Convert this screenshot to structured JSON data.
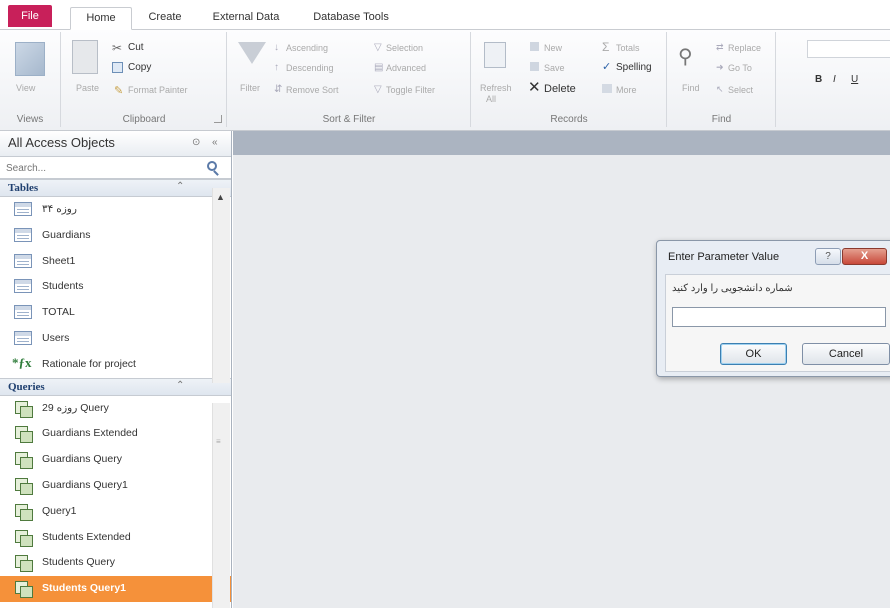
{
  "tabs": [
    {
      "label": "File"
    },
    {
      "label": "Home"
    },
    {
      "label": "Create"
    },
    {
      "label": "External Data"
    },
    {
      "label": "Database Tools"
    }
  ],
  "ribbon": {
    "views": {
      "view": "View",
      "group": "Views"
    },
    "clipboard": {
      "paste": "Paste",
      "cut": "Cut",
      "copy": "Copy",
      "format_painter": "Format Painter",
      "group": "Clipboard"
    },
    "sort_filter": {
      "filter": "Filter",
      "ascending": "Ascending",
      "descending": "Descending",
      "remove_sort": "Remove Sort",
      "selection": "Selection",
      "advanced": "Advanced",
      "toggle_filter": "Toggle Filter",
      "group": "Sort & Filter"
    },
    "records": {
      "refresh": "Refresh",
      "refresh_sub": "All",
      "new": "New",
      "save": "Save",
      "delete": "Delete",
      "totals": "Totals",
      "spelling": "Spelling",
      "more": "More",
      "group": "Records"
    },
    "find": {
      "find": "Find",
      "replace": "Replace",
      "goto": "Go To",
      "select": "Select",
      "group": "Find"
    },
    "format": {
      "bold": "B",
      "italic": "I",
      "underline": "U"
    }
  },
  "nav": {
    "title": "All Access Objects",
    "search_placeholder": "Search...",
    "tables_title": "Tables",
    "tables": [
      "روزه ۳۴",
      "Guardians",
      "Sheet1",
      "Students",
      "TOTAL",
      "Users"
    ],
    "macro": "Rationale for project",
    "queries_title": "Queries",
    "queries": [
      "روزه 29 Query",
      "Guardians Extended",
      "Guardians Query",
      "Guardians Query1",
      "Query1",
      "Students Extended",
      "Students Query",
      "Students Query1"
    ]
  },
  "dialog": {
    "title": "Enter Parameter Value",
    "help": "?",
    "close": "X",
    "prompt": "شماره دانشجویی را وارد کنید",
    "value": "",
    "ok": "OK",
    "cancel": "Cancel"
  },
  "colors": {
    "file_tab": "#c8205a",
    "selected_item": "#f5913a",
    "workspace": "#e9ebee"
  }
}
